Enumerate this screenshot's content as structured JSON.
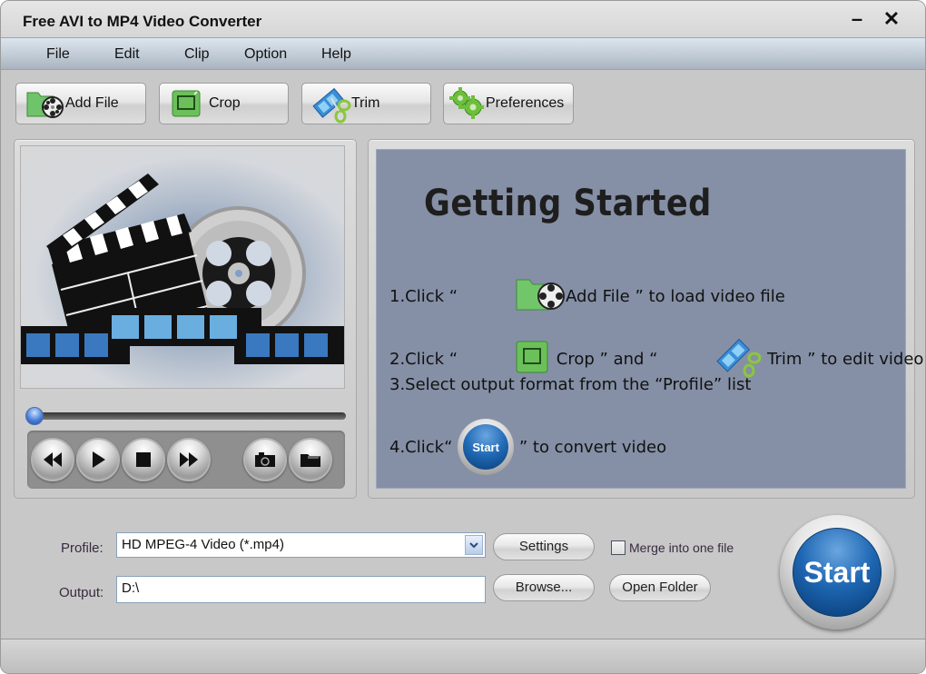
{
  "window": {
    "title": "Free AVI to MP4 Video Converter",
    "minimize_label": "–",
    "close_label": "✕"
  },
  "menu": {
    "items": [
      {
        "label": "File"
      },
      {
        "label": "Edit"
      },
      {
        "label": "Clip"
      },
      {
        "label": "Option"
      },
      {
        "label": "Help"
      }
    ]
  },
  "toolbar": {
    "add_file": {
      "label": "Add File",
      "icon": "folder-film-reel-icon"
    },
    "crop": {
      "label": "Crop",
      "icon": "crop-icon"
    },
    "trim": {
      "label": "Trim",
      "icon": "film-scissors-icon"
    },
    "preferences": {
      "label": "Preferences",
      "icon": "gears-icon"
    }
  },
  "player": {
    "progress_fraction": 0,
    "controls": [
      {
        "name": "rewind",
        "icon": "rewind-icon"
      },
      {
        "name": "play",
        "icon": "play-icon"
      },
      {
        "name": "stop",
        "icon": "stop-icon"
      },
      {
        "name": "fast-forward",
        "icon": "fast-forward-icon"
      },
      {
        "name": "snapshot",
        "icon": "camera-icon"
      },
      {
        "name": "open-snapshot-folder",
        "icon": "folder-icon"
      }
    ]
  },
  "guide": {
    "title": "Getting Started",
    "step1_pre": "1.Click “ ",
    "step1_post": "Add File ” to load video file",
    "step2_pre": "2.Click “ ",
    "step2_mid": " Crop ” and “ ",
    "step2_post": " Trim ” to edit video file",
    "step3": "3.Select output format from the “Profile” list",
    "step4_pre": "4.Click“ ",
    "step4_icon_label": "Start",
    "step4_post": " ” to convert video"
  },
  "output": {
    "profile_label": "Profile:",
    "profile_value": "HD MPEG-4 Video (*.mp4)",
    "output_label": "Output:",
    "output_value": "D:\\",
    "settings_label": "Settings",
    "browse_label": "Browse...",
    "open_folder_label": "Open Folder",
    "merge_label": "Merge into one file",
    "merge_checked": false,
    "start_label": "Start"
  },
  "colors": {
    "guide_bg": "#8590a6",
    "start_blue": "#1f68b4",
    "window_bg": "#c8c8c8"
  }
}
